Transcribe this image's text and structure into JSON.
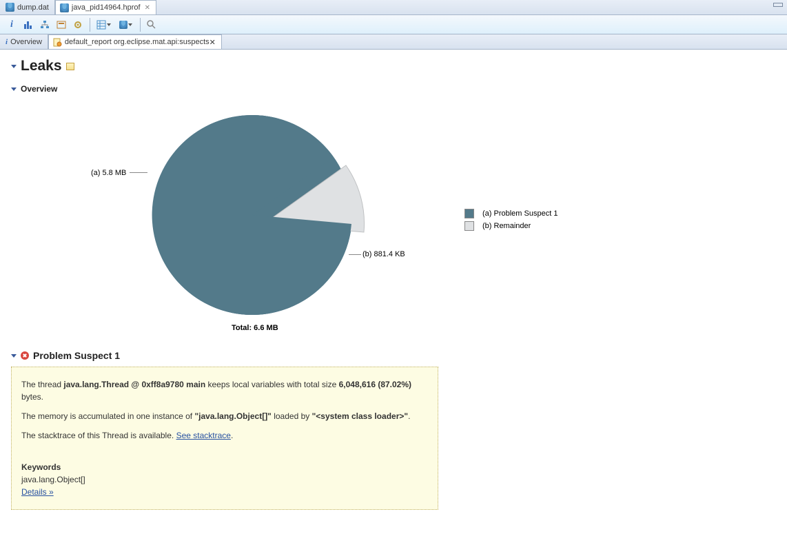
{
  "editor_tabs": {
    "items": [
      {
        "label": "dump.dat",
        "active": false,
        "closable": false
      },
      {
        "label": "java_pid14964.hprof",
        "active": true,
        "closable": true
      }
    ]
  },
  "sub_tabs": {
    "items": [
      {
        "label": "Overview",
        "active": false,
        "closable": false,
        "icon": "info"
      },
      {
        "label": "default_report  org.eclipse.mat.api:suspects",
        "active": true,
        "closable": true,
        "icon": "report"
      }
    ]
  },
  "sections": {
    "leaks_title": "Leaks",
    "overview_title": "Overview",
    "problem_title": "Problem Suspect 1"
  },
  "chart_data": {
    "type": "pie",
    "title": "",
    "total_label": "Total: 6.6 MB",
    "slices": [
      {
        "id": "a",
        "label": "(a)  5.8 MB",
        "legend": "(a)  Problem Suspect 1",
        "value_mb": 5.8,
        "percent": 87.0,
        "color": "#537a8a",
        "exploded": false
      },
      {
        "id": "b",
        "label": "(b)  881.4 KB",
        "legend": "(b)  Remainder",
        "value_mb": 0.86,
        "percent": 13.0,
        "color": "#dfe1e3",
        "exploded": true
      }
    ]
  },
  "suspect": {
    "p1_pre": "The thread ",
    "p1_bold": "java.lang.Thread @ 0xff8a9780 main",
    "p1_mid": " keeps local variables with total size ",
    "p1_size": "6,048,616 (87.02%)",
    "p1_post": " bytes.",
    "p2_pre": "The memory is accumulated in one instance of ",
    "p2_bold1": "\"java.lang.Object[]\"",
    "p2_mid": " loaded by ",
    "p2_bold2": "\"<system class loader>\"",
    "p2_post": ".",
    "p3_pre": "The stacktrace of this Thread is available. ",
    "p3_link": "See stacktrace",
    "p3_post": ".",
    "keywords_label": "Keywords",
    "keywords_value": "java.lang.Object[]",
    "details_link": "Details »"
  }
}
